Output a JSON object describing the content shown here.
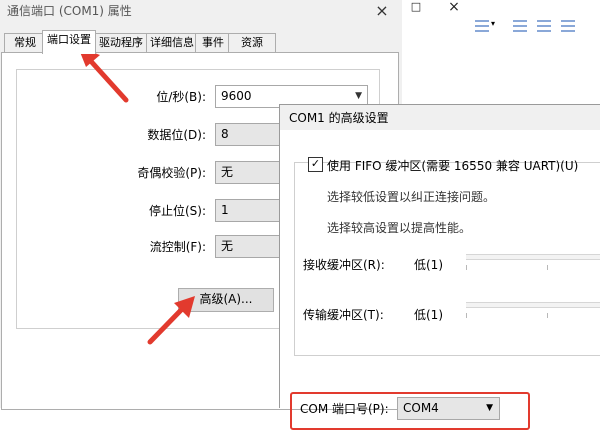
{
  "background_window": {
    "controls": [
      "□",
      "×"
    ]
  },
  "properties_dialog": {
    "title": "通信端口 (COM1) 属性",
    "close": "×",
    "tabs": [
      "常规",
      "端口设置",
      "驱动程序",
      "详细信息",
      "事件",
      "资源"
    ],
    "active_tab": "端口设置",
    "fields": [
      {
        "label": "位/秒(B):",
        "value": "9600"
      },
      {
        "label": "数据位(D):",
        "value": "8"
      },
      {
        "label": "奇偶校验(P):",
        "value": "无"
      },
      {
        "label": "停止位(S):",
        "value": "1"
      },
      {
        "label": "流控制(F):",
        "value": "无"
      }
    ],
    "advanced_button": "高级(A)..."
  },
  "advanced_dialog": {
    "title": "COM1 的高级设置",
    "fifo_checkbox": {
      "label": "使用 FIFO 缓冲区(需要 16550 兼容 UART)(U)",
      "checked": true,
      "mark": "✓"
    },
    "hint_low": "选择较低设置以纠正连接问题。",
    "hint_high": "选择较高设置以提高性能。",
    "receive_buffer": {
      "label": "接收缓冲区(R):",
      "value": "低(1)"
    },
    "transmit_buffer": {
      "label": "传输缓冲区(T):",
      "value": "低(1)"
    },
    "com_port": {
      "label": "COM 端口号(P):",
      "value": "COM4"
    }
  },
  "accent_colors": {
    "annotation_red": "#e23a2e"
  }
}
